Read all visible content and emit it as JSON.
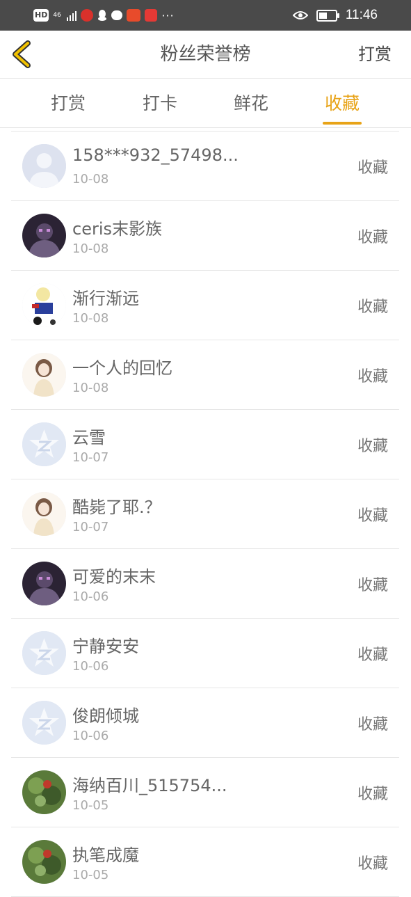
{
  "status_bar": {
    "hd": "HD",
    "network": "46",
    "time": "11:46",
    "battery_level": 0.5,
    "more": "···"
  },
  "header": {
    "title": "粉丝荣誉榜",
    "right_action": "打赏"
  },
  "tabs": [
    {
      "label": "打赏"
    },
    {
      "label": "打卡"
    },
    {
      "label": "鲜花"
    },
    {
      "label": "收藏"
    }
  ],
  "active_tab_index": 3,
  "colors": {
    "accent": "#e8a317"
  },
  "fans": [
    {
      "name": "158***932_57498...",
      "date": "10-08",
      "action": "收藏",
      "avatar": "default-user-avatar"
    },
    {
      "name": "ceris末影族",
      "date": "10-08",
      "action": "收藏",
      "avatar": "dark-figure-avatar"
    },
    {
      "name": "渐行渐远",
      "date": "10-08",
      "action": "收藏",
      "avatar": "cartoon-character-avatar"
    },
    {
      "name": "一个人的回忆",
      "date": "10-08",
      "action": "收藏",
      "avatar": "anime-girl-avatar"
    },
    {
      "name": "云雪",
      "date": "10-07",
      "action": "收藏",
      "avatar": "qq-star-avatar"
    },
    {
      "name": "酷毙了耶.？",
      "date": "10-07",
      "action": "收藏",
      "avatar": "anime-girl-avatar"
    },
    {
      "name": "可爱的末末",
      "date": "10-06",
      "action": "收藏",
      "avatar": "dark-figure-avatar"
    },
    {
      "name": "宁静安安",
      "date": "10-06",
      "action": "收藏",
      "avatar": "qq-star-avatar"
    },
    {
      "name": "俊朗倾城",
      "date": "10-06",
      "action": "收藏",
      "avatar": "qq-star-avatar"
    },
    {
      "name": "海纳百川_515754...",
      "date": "10-05",
      "action": "收藏",
      "avatar": "nature-photo-avatar"
    },
    {
      "name": "执笔成魔",
      "date": "10-05",
      "action": "收藏",
      "avatar": "nature-photo-avatar"
    }
  ]
}
